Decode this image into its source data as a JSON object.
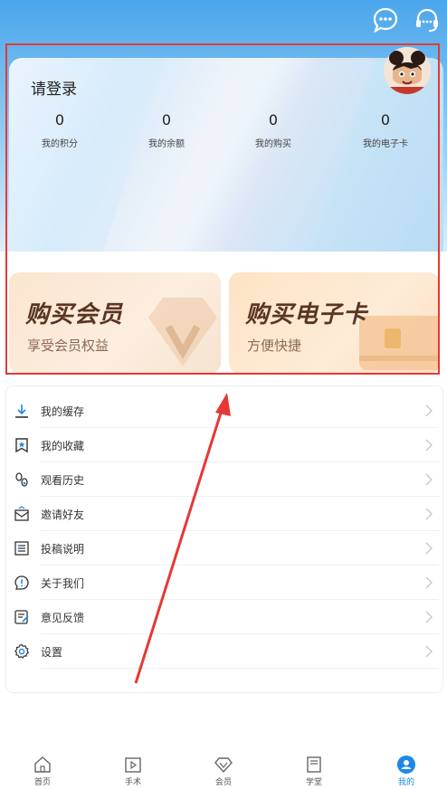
{
  "header": {
    "message_icon": "chat-bubble-icon",
    "service_icon": "headset-icon"
  },
  "profile": {
    "login_text": "请登录",
    "stats": [
      {
        "value": "0",
        "label": "我的积分"
      },
      {
        "value": "0",
        "label": "我的余额"
      },
      {
        "value": "0",
        "label": "我的购买"
      },
      {
        "value": "0",
        "label": "我的电子卡"
      }
    ],
    "avatar": "cartoon-avatar"
  },
  "promos": [
    {
      "title": "购买会员",
      "subtitle": "享受会员权益"
    },
    {
      "title": "购买电子卡",
      "subtitle": "方便快捷"
    }
  ],
  "menu": [
    {
      "label": "我的缓存",
      "icon": "download-icon"
    },
    {
      "label": "我的收藏",
      "icon": "bookmark-star-icon"
    },
    {
      "label": "观看历史",
      "icon": "footprint-icon"
    },
    {
      "label": "邀请好友",
      "icon": "invite-envelope-icon"
    },
    {
      "label": "投稿说明",
      "icon": "document-list-icon"
    },
    {
      "label": "关于我们",
      "icon": "info-bubble-icon"
    },
    {
      "label": "意见反馈",
      "icon": "feedback-edit-icon"
    },
    {
      "label": "设置",
      "icon": "gear-icon"
    }
  ],
  "tabs": [
    {
      "label": "首页",
      "icon": "home-icon"
    },
    {
      "label": "手术",
      "icon": "video-play-icon"
    },
    {
      "label": "会员",
      "icon": "diamond-icon"
    },
    {
      "label": "学堂",
      "icon": "book-icon"
    },
    {
      "label": "我的",
      "icon": "profile-icon",
      "active": true
    }
  ],
  "colors": {
    "accent": "#1e88e5",
    "highlight_box": "#e53935",
    "promo_text": "#5a3523"
  }
}
